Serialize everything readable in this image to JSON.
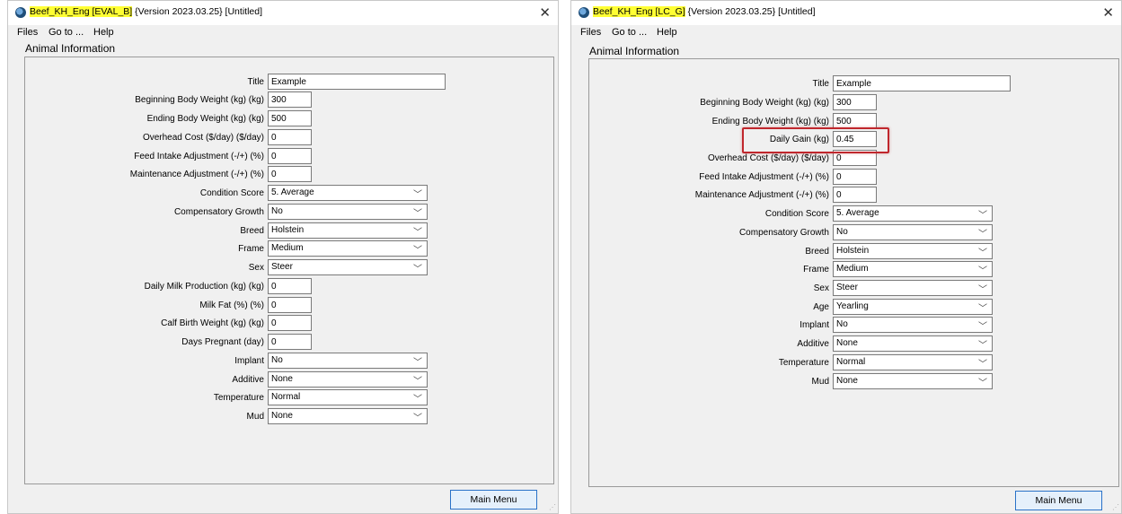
{
  "left": {
    "title": {
      "app": "Beef_KH_Eng [EVAL_B]",
      "rest": " {Version 2023.03.25} [Untitled]"
    },
    "menu": [
      "Files",
      "Go to ...",
      "Help"
    ],
    "section": "Animal Information",
    "fields": {
      "title": {
        "label": "Title",
        "value": "Example"
      },
      "begin_bw": {
        "label": "Beginning Body Weight (kg) (kg)",
        "value": "300"
      },
      "end_bw": {
        "label": "Ending Body Weight (kg) (kg)",
        "value": "500"
      },
      "overhead": {
        "label": "Overhead Cost ($/day) ($/day)",
        "value": "0"
      },
      "intake": {
        "label": "Feed Intake Adjustment (-/+) (%)",
        "value": "0"
      },
      "maint": {
        "label": "Maintenance Adjustment (-/+) (%)",
        "value": "0"
      },
      "condition": {
        "label": "Condition Score",
        "value": "5. Average"
      },
      "comp_growth": {
        "label": "Compensatory Growth",
        "value": "No"
      },
      "breed": {
        "label": "Breed",
        "value": "Holstein"
      },
      "frame": {
        "label": "Frame",
        "value": "Medium"
      },
      "sex": {
        "label": "Sex",
        "value": "Steer"
      },
      "milk": {
        "label": "Daily Milk Production (kg) (kg)",
        "value": "0"
      },
      "milk_fat": {
        "label": "Milk Fat (%) (%)",
        "value": "0"
      },
      "calf_bw": {
        "label": "Calf Birth Weight (kg) (kg)",
        "value": "0"
      },
      "days_preg": {
        "label": "Days Pregnant (day)",
        "value": "0"
      },
      "implant": {
        "label": "Implant",
        "value": "No"
      },
      "additive": {
        "label": "Additive",
        "value": "None"
      },
      "temperature": {
        "label": "Temperature",
        "value": "Normal"
      },
      "mud": {
        "label": "Mud",
        "value": "None"
      }
    },
    "main_menu": "Main Menu"
  },
  "right": {
    "title": {
      "app": "Beef_KH_Eng [LC_G]",
      "rest": " {Version 2023.03.25} [Untitled]"
    },
    "menu": [
      "Files",
      "Go to ...",
      "Help"
    ],
    "section": "Animal Information",
    "fields": {
      "title": {
        "label": "Title",
        "value": "Example"
      },
      "begin_bw": {
        "label": "Beginning Body Weight (kg) (kg)",
        "value": "300"
      },
      "end_bw": {
        "label": "Ending Body Weight (kg) (kg)",
        "value": "500"
      },
      "daily_gain": {
        "label": "Daily Gain (kg)",
        "value": "0.45"
      },
      "overhead": {
        "label": "Overhead Cost ($/day) ($/day)",
        "value": "0"
      },
      "intake": {
        "label": "Feed Intake Adjustment (-/+) (%)",
        "value": "0"
      },
      "maint": {
        "label": "Maintenance Adjustment (-/+) (%)",
        "value": "0"
      },
      "condition": {
        "label": "Condition Score",
        "value": "5. Average"
      },
      "comp_growth": {
        "label": "Compensatory Growth",
        "value": "No"
      },
      "breed": {
        "label": "Breed",
        "value": "Holstein"
      },
      "frame": {
        "label": "Frame",
        "value": "Medium"
      },
      "sex": {
        "label": "Sex",
        "value": "Steer"
      },
      "age": {
        "label": "Age",
        "value": "Yearling"
      },
      "implant": {
        "label": "Implant",
        "value": "No"
      },
      "additive": {
        "label": "Additive",
        "value": "None"
      },
      "temperature": {
        "label": "Temperature",
        "value": "Normal"
      },
      "mud": {
        "label": "Mud",
        "value": "None"
      }
    },
    "main_menu": "Main Menu"
  },
  "colors": {
    "title_highlight": "#ffff33",
    "annotation": "#c0272d",
    "button_border": "#2a72c8"
  },
  "icons": {
    "app": "app-icon",
    "close": "close-icon",
    "dropdown": "chevron-down-icon"
  }
}
